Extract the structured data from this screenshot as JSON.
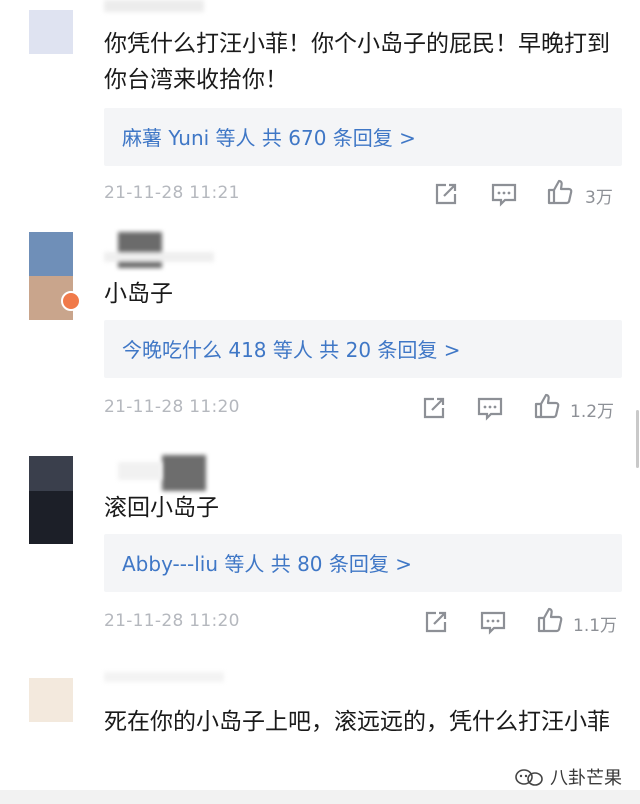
{
  "comments": [
    {
      "text": "你凭什么打汪小菲！你个小岛子的屁民！早晚打到你台湾来收拾你！",
      "replies_who": "麻薯 Yuni",
      "replies_mid": " 等人 ",
      "replies_count": "共 670 条回复 >",
      "time": "21-11-28 11:21",
      "likes": "3万"
    },
    {
      "text": "小岛子",
      "replies_who": "今晚吃什么 418",
      "replies_mid": " 等人 ",
      "replies_count": "共 20 条回复 >",
      "time": "21-11-28 11:20",
      "likes": "1.2万"
    },
    {
      "text": "滚回小岛子",
      "replies_who": "Abby---liu",
      "replies_mid": " 等人 ",
      "replies_count": "共 80 条回复 >",
      "time": "21-11-28 11:20",
      "likes": "1.1万"
    },
    {
      "text": "死在你的小岛子上吧，滚远远的，凭什么打汪小菲"
    }
  ],
  "watermark": "八卦芒果",
  "icons": {
    "share": "share-icon",
    "comment": "comment-icon",
    "like": "thumbs-up-icon"
  },
  "colors": {
    "link": "#3f77c6",
    "reply_bg": "#f4f5f7",
    "meta": "#b5b8be"
  }
}
